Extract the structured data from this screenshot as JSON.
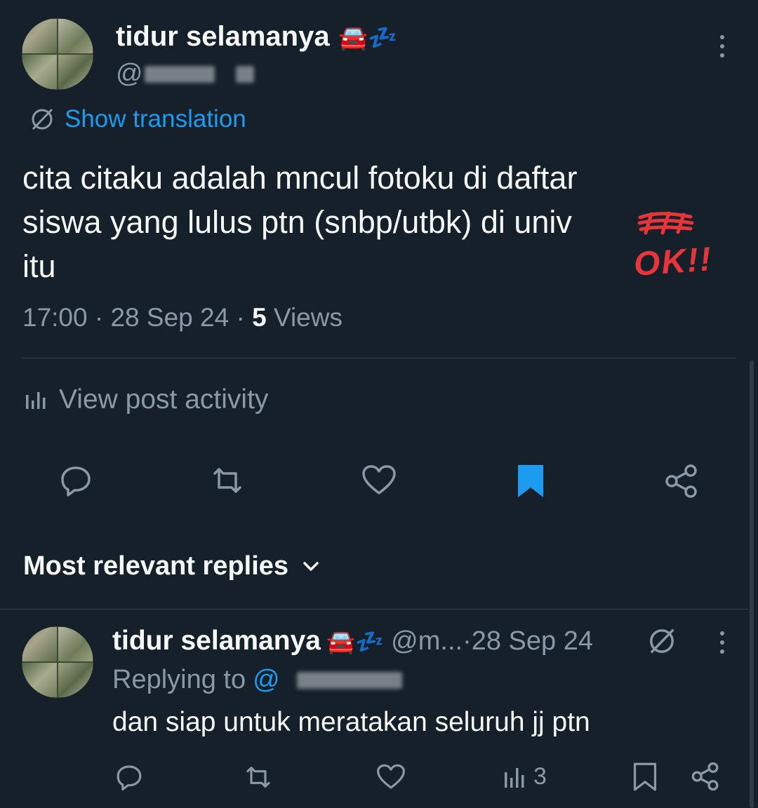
{
  "tweet": {
    "author_name": "tidur selamanya",
    "author_emoji": "🚘💤",
    "handle_prefix": "@",
    "translate_label": "Show translation",
    "text_line1": "cita citaku adalah mncul fotoku di daftar",
    "text_line2": "siswa yang lulus ptn (snbp/utbk) di univ",
    "text_line3": "itu",
    "annotation": "OK!!",
    "time": "17:00",
    "date": "28 Sep 24",
    "views_count": "5",
    "views_label": "Views",
    "activity_label": "View post activity"
  },
  "replies_header": {
    "label": "Most relevant replies"
  },
  "reply": {
    "author_name": "tidur selamanya",
    "author_emoji": "🚘💤",
    "handle": "@m...",
    "date": "28 Sep 24",
    "replying_to_label": "Replying to",
    "replying_to_handle": "@",
    "text": "dan siap untuk meratakan seluruh jj ptn",
    "views": "3"
  },
  "colors": {
    "background": "#15202b",
    "accent": "#1d9bf0",
    "muted": "#8b98a5",
    "annotation": "#e8353a"
  },
  "icons": {
    "action_bar": [
      "reply-icon",
      "retweet-icon",
      "like-icon",
      "bookmark-filled-icon",
      "share-icon"
    ],
    "reply_action_bar": [
      "reply-icon",
      "retweet-icon",
      "like-icon",
      "views-icon",
      "bookmark-icon",
      "share-icon"
    ]
  }
}
